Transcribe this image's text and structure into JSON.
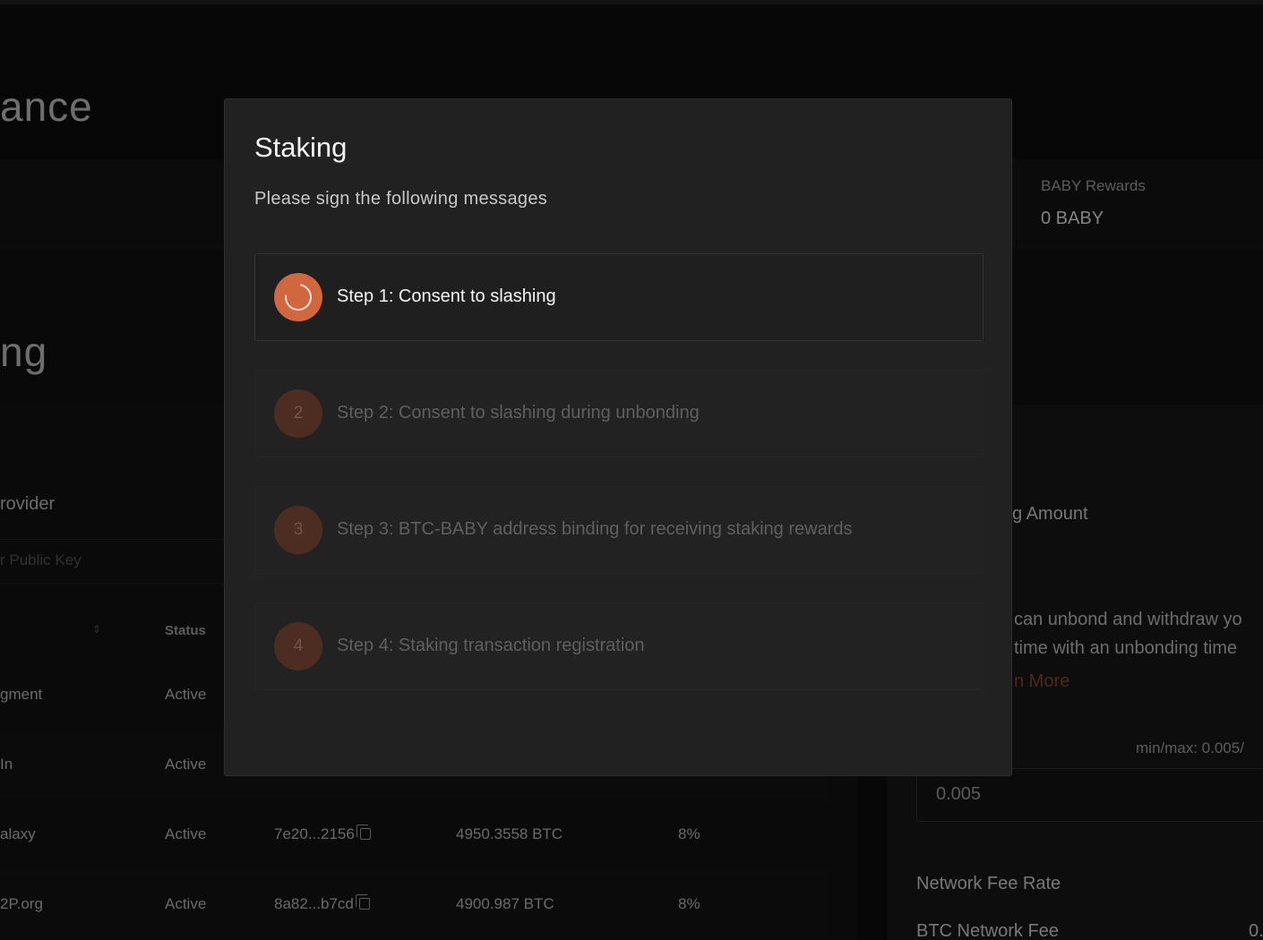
{
  "background": {
    "title_fragment": "ance",
    "section_fragment": "ng",
    "rewards": {
      "label": "BABY Rewards",
      "value": "0 BABY"
    },
    "provider_label": "rovider",
    "search_placeholder": "r Public Key",
    "table": {
      "status_header": "Status",
      "rows": [
        {
          "name": "gment",
          "status": "Active",
          "key": "",
          "stake": "",
          "commission": ""
        },
        {
          "name": "In",
          "status": "Active",
          "key": "",
          "stake": "",
          "commission": ""
        },
        {
          "name": "alaxy",
          "status": "Active",
          "key": "7e20...2156",
          "stake": "4950.3558 BTC",
          "commission": "8%"
        },
        {
          "name": "2P.org",
          "status": "Active",
          "key": "8a82...b7cd",
          "stake": "4900.987 BTC",
          "commission": "8%"
        }
      ]
    },
    "right_panel": {
      "amount_label": "g Amount",
      "info_line_1": "can unbond and withdraw yo",
      "info_line_2": "time with an unbonding time",
      "learn_more": "n More",
      "minmax": "min/max: 0.005/",
      "amount_value": "0.005",
      "fee_rate_label": "Network Fee Rate",
      "btc_fee_label": "BTC Network Fee",
      "btc_fee_value": "0."
    },
    "accent_color": "#d0673f"
  },
  "modal": {
    "title": "Staking",
    "subtitle": "Please sign the following messages",
    "steps": [
      {
        "number": "1",
        "label": "Step 1: Consent to slashing",
        "state": "active"
      },
      {
        "number": "2",
        "label": "Step 2: Consent to slashing during unbonding",
        "state": "pending"
      },
      {
        "number": "3",
        "label": "Step 3: BTC-BABY address binding for receiving staking rewards",
        "state": "pending"
      },
      {
        "number": "4",
        "label": "Step 4: Staking transaction registration",
        "state": "pending"
      }
    ]
  }
}
